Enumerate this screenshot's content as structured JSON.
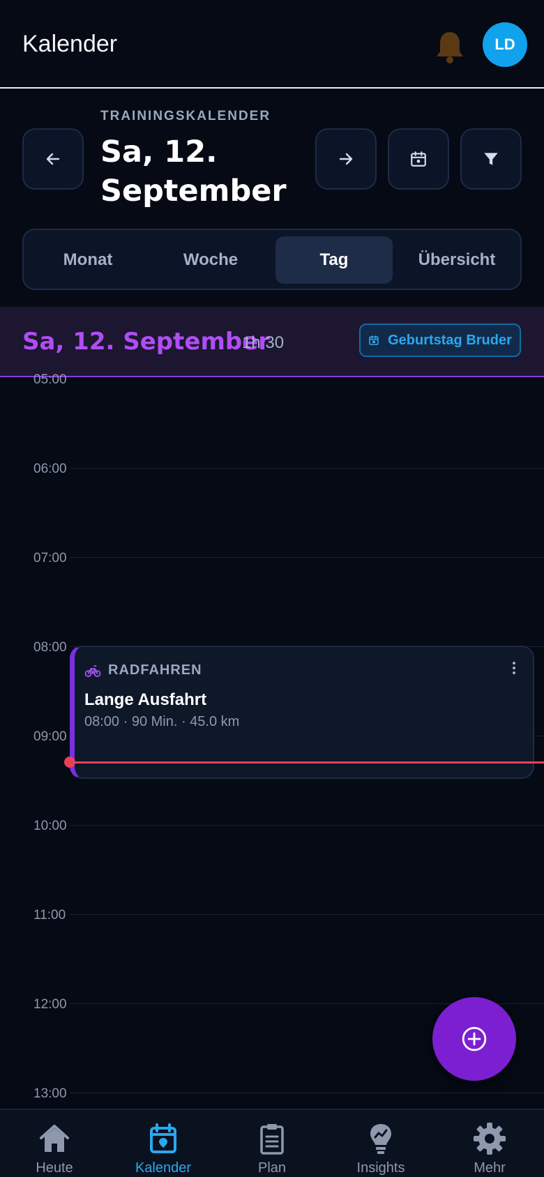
{
  "header": {
    "title": "Kalender",
    "avatar_initials": "LD"
  },
  "navigator": {
    "overline": "TRAININGSKALENDER",
    "date_line1": "Sa, 12.",
    "date_line2": "September"
  },
  "view_tabs": [
    {
      "label": "Monat",
      "active": false
    },
    {
      "label": "Woche",
      "active": false
    },
    {
      "label": "Tag",
      "active": true
    },
    {
      "label": "Übersicht",
      "active": false
    }
  ],
  "day": {
    "date": "Sa, 12. September",
    "duration": "1h 30",
    "birthday_chip": "Geburtstag Bruder"
  },
  "hours": [
    "05:00",
    "06:00",
    "07:00",
    "08:00",
    "09:00",
    "10:00",
    "11:00",
    "12:00",
    "13:00"
  ],
  "event": {
    "type": "RADFAHREN",
    "title": "Lange Ausfahrt",
    "meta": "08:00 · 90 Min. · 45.0 km"
  },
  "bottom_nav": [
    {
      "label": "Heute",
      "icon": "home-icon",
      "active": false
    },
    {
      "label": "Kalender",
      "icon": "calendar-icon",
      "active": true
    },
    {
      "label": "Plan",
      "icon": "clipboard-icon",
      "active": false
    },
    {
      "label": "Insights",
      "icon": "lightbulb-icon",
      "active": false
    },
    {
      "label": "Mehr",
      "icon": "gear-icon",
      "active": false
    }
  ],
  "colors": {
    "background": "#050a14",
    "accent_blue": "#2aa8f0",
    "accent_purple": "#b04df5",
    "now_line": "#e8405a",
    "fab": "#7b1fd0"
  }
}
